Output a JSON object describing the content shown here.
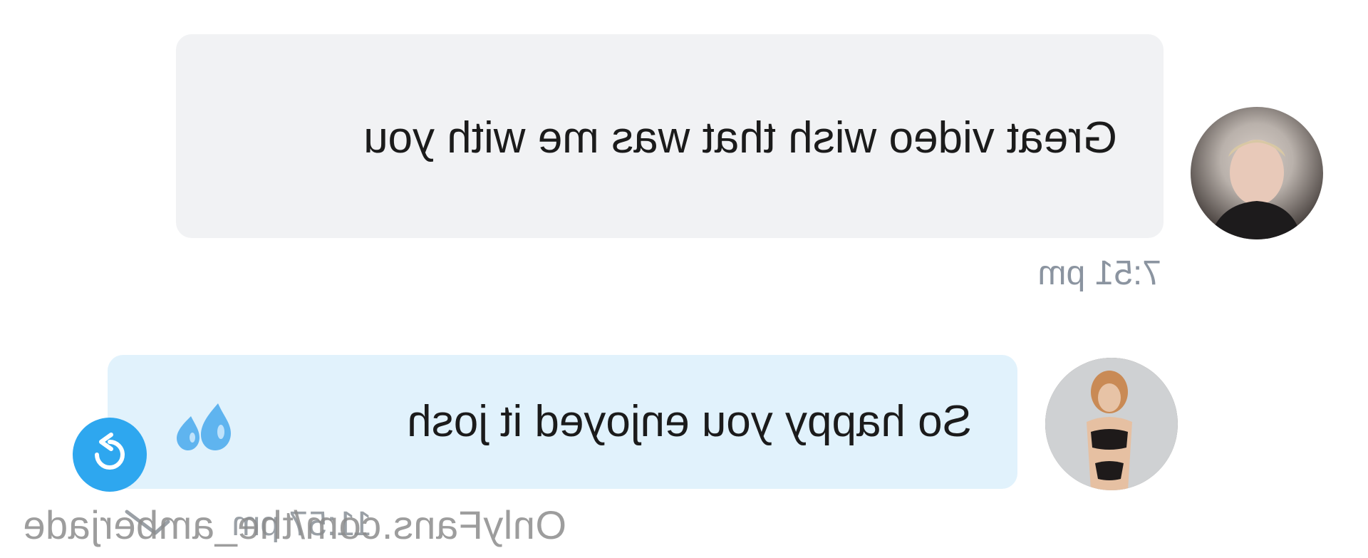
{
  "messages": [
    {
      "text": "Great video wish that was me with you",
      "time": "7:51 pm"
    },
    {
      "text": "So happy you enjoyed it josh",
      "emoji": "droplets-icon",
      "time": "11:57 pm"
    }
  ],
  "watermark": "OnlyFans.com/the_amberjade",
  "colors": {
    "incoming_bubble": "#f1f2f4",
    "outgoing_bubble": "#e1f2fc",
    "accent": "#2ea7ef",
    "timestamp": "#8b94a0"
  }
}
